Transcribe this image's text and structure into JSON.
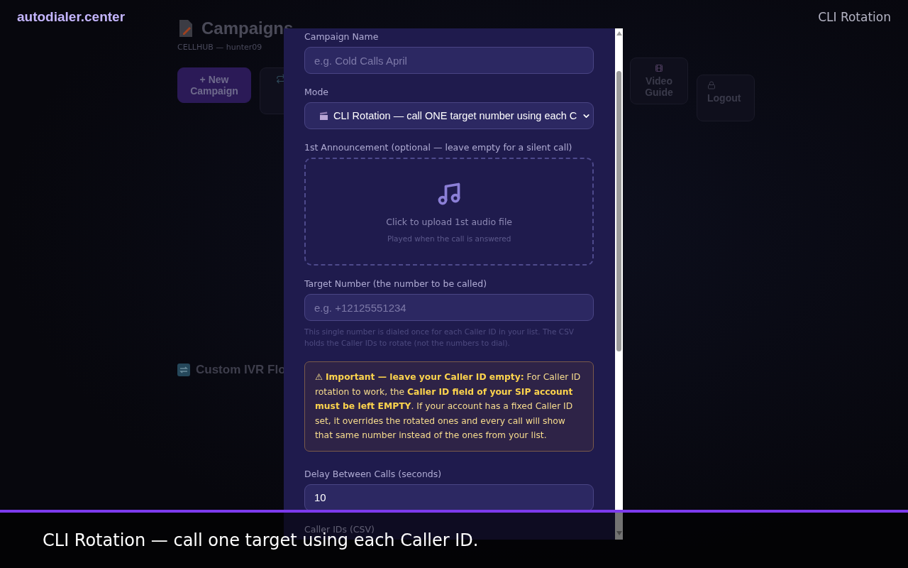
{
  "top_bar": {
    "brand": "autodialer.center",
    "section": "CLI Rotation"
  },
  "page": {
    "title": "Campaigns",
    "subtitle": "CELLHUB — hunter09",
    "buttons": [
      {
        "kind": "create",
        "label": "+ New Campaign"
      },
      {
        "kind": "covered"
      },
      {
        "kind": "video",
        "label": "Video Guide"
      },
      {
        "kind": "logout",
        "label": "Logout"
      }
    ],
    "section_title": "Custom IVR Flo"
  },
  "modal": {
    "fields": [
      {
        "kind": "text",
        "label": "Campaign Name",
        "placeholder": "e.g. Cold Calls April"
      },
      {
        "kind": "select",
        "label": "Mode",
        "value": "CLI Rotation — call ONE target number using each C"
      },
      {
        "kind": "upload",
        "label": "1st Announcement (optional — leave empty for a silent call)",
        "title": "Click to upload 1st audio file",
        "hint": "Played when the call is answered"
      },
      {
        "kind": "text",
        "label": "Target Number (the number to be called)",
        "placeholder": "e.g. +12125551234",
        "help": "This single number is dialed once for each Caller ID in your list. The CSV holds the Caller IDs to rotate (not the numbers to dial)."
      },
      {
        "kind": "warning",
        "text": "⚠ **Important — leave your Caller ID empty:** For Caller ID rotation to work, the **Caller ID field of your SIP account must be left EMPTY**. If your account has a fixed Caller ID set, it overrides the rotated ones and every call will show that same number instead of the ones from your list."
      },
      {
        "kind": "text",
        "label": "Delay Between Calls (seconds)",
        "value": "10"
      },
      {
        "kind": "label",
        "label": "Caller IDs (CSV)"
      }
    ]
  },
  "caption": {
    "text": "CLI Rotation — call one target using each Caller ID."
  }
}
